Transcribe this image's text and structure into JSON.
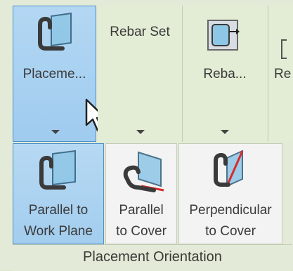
{
  "ribbon": {
    "top_buttons": [
      {
        "label": "Placeme..."
      },
      {
        "label": "Rebar Set"
      },
      {
        "label": "Reba..."
      },
      {
        "label": "Re"
      }
    ],
    "orientation_buttons": [
      {
        "line1": "Parallel to",
        "line2": "Work Plane"
      },
      {
        "line1": "Parallel",
        "line2": "to Cover"
      },
      {
        "line1": "Perpendicular",
        "line2": "to Cover"
      }
    ],
    "panel_title": "Placement Orientation"
  }
}
